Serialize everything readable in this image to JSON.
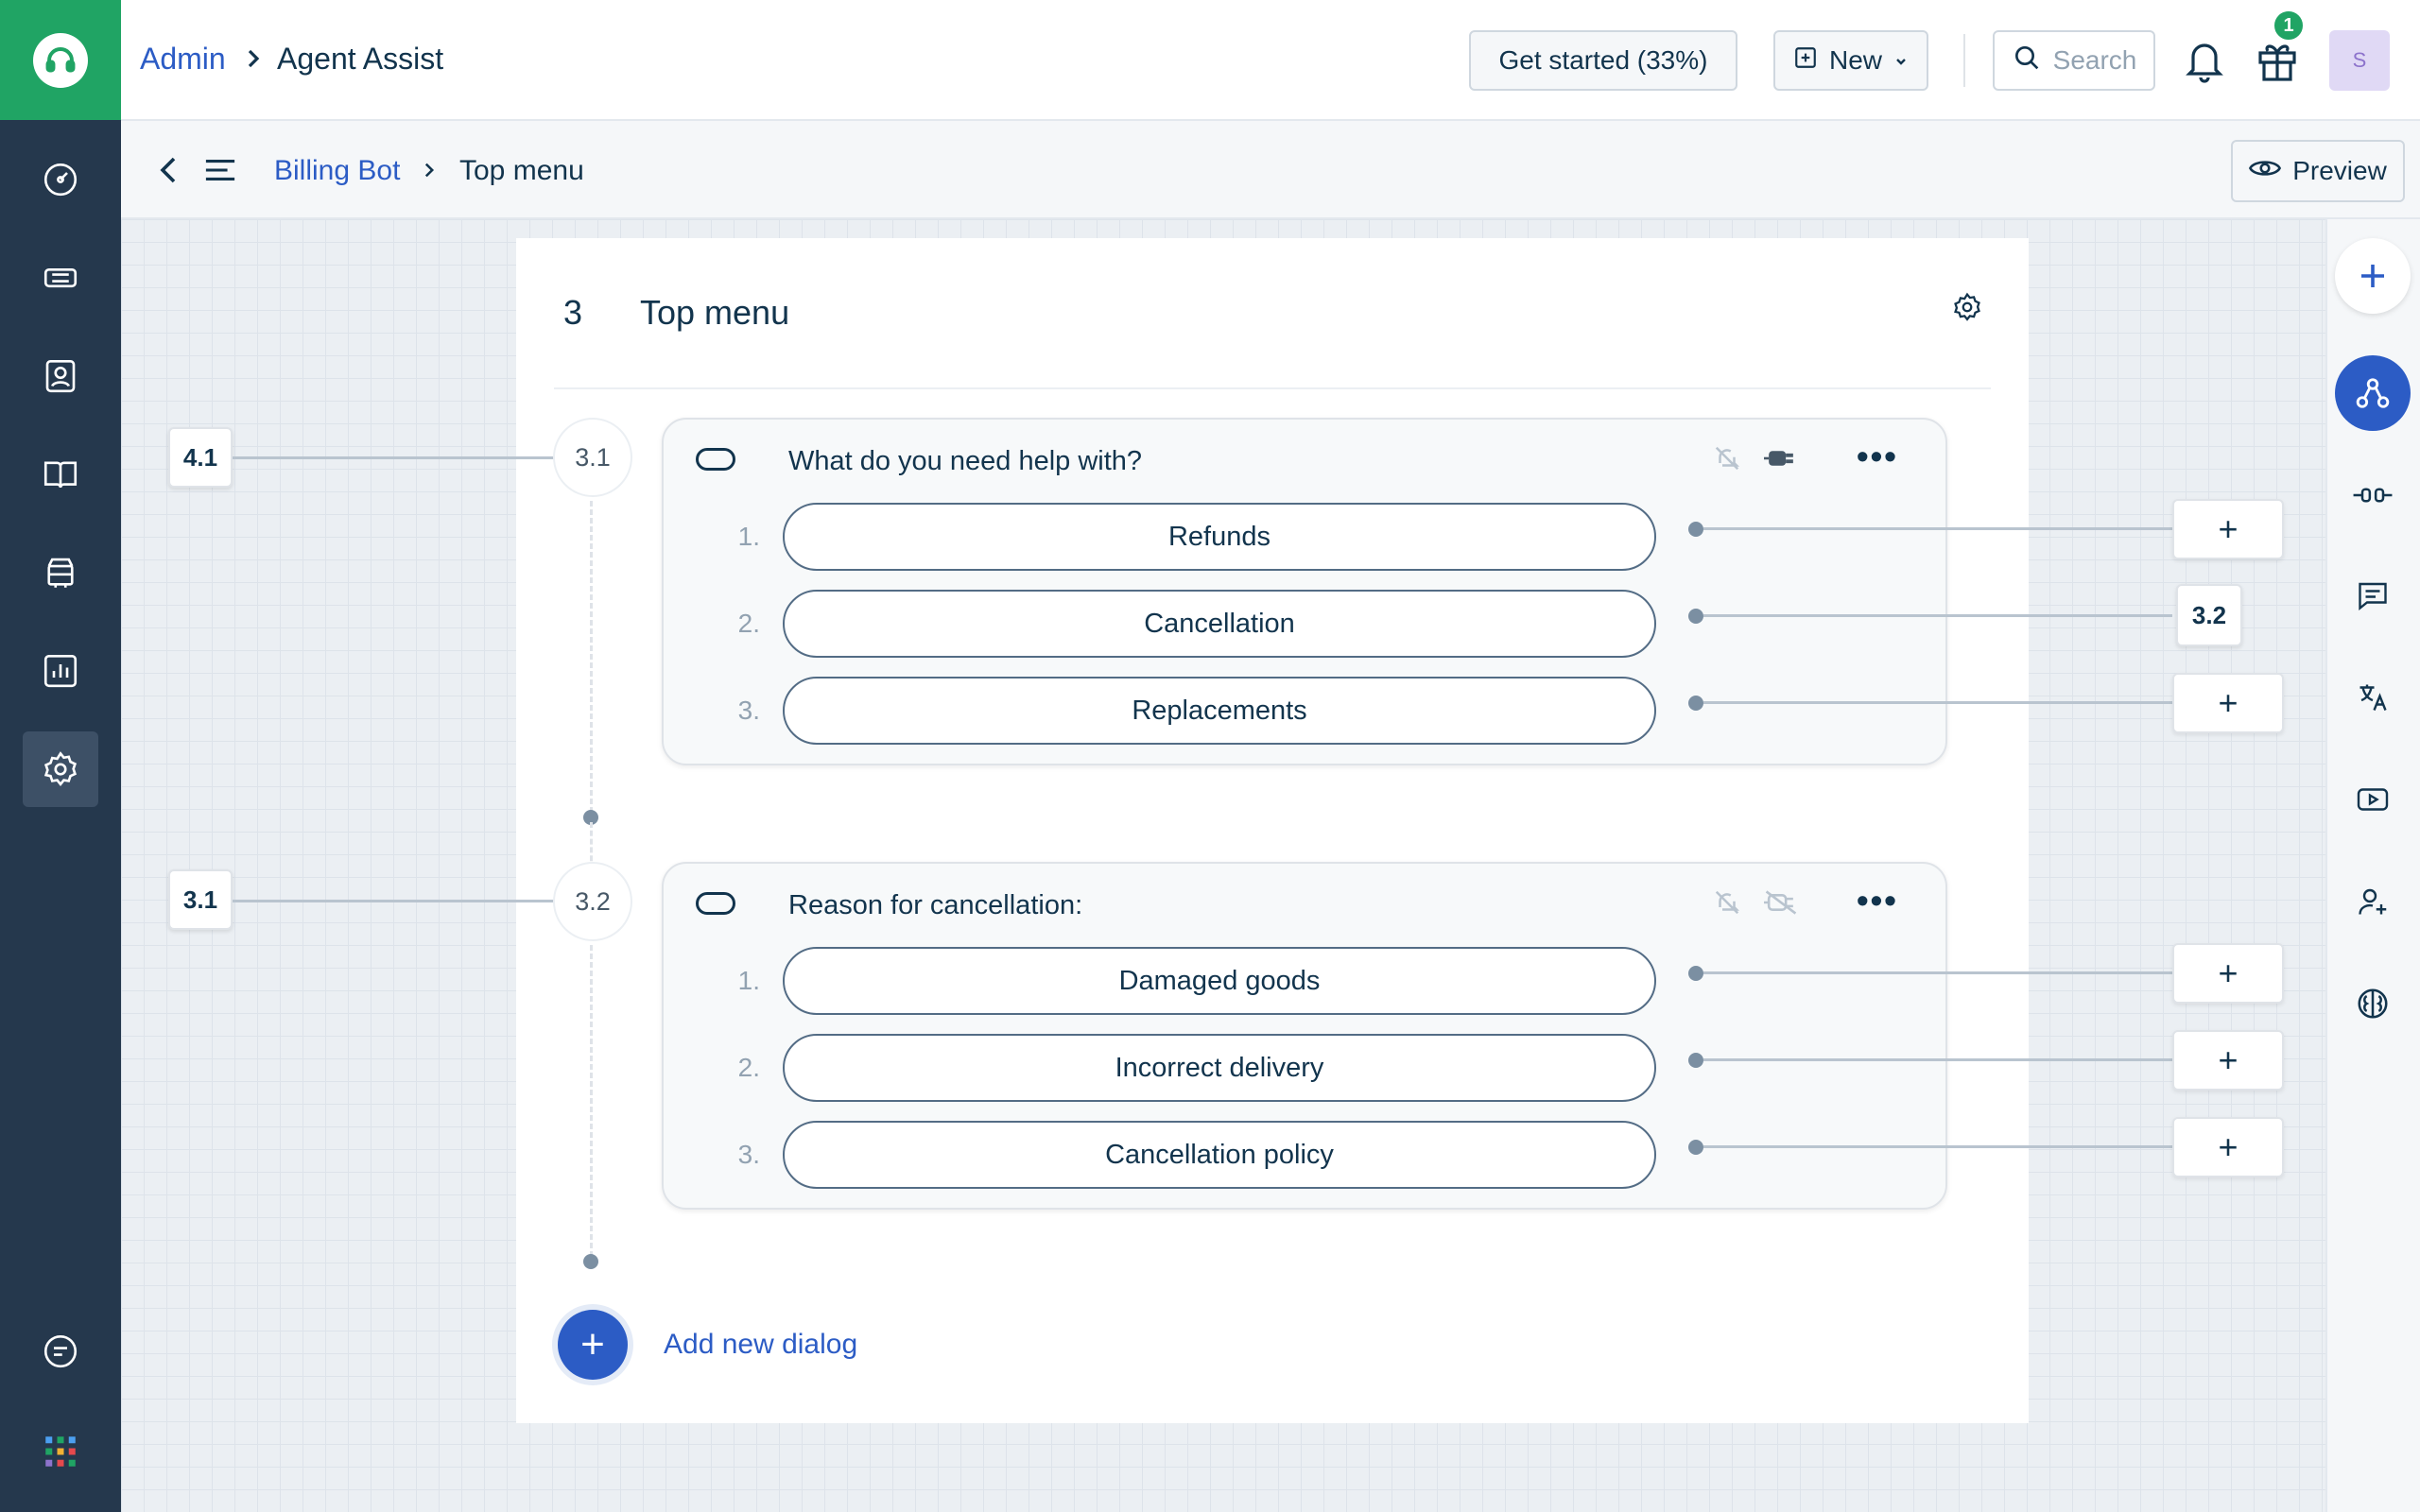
{
  "header": {
    "breadcrumb_root": "Admin",
    "breadcrumb_title": "Agent Assist",
    "get_started": "Get started (33%)",
    "new_button": "New",
    "search_placeholder": "Search",
    "notifications_badge": "1",
    "avatar_initial": "S"
  },
  "subheader": {
    "bot_name": "Billing Bot",
    "current": "Top menu",
    "preview": "Preview"
  },
  "panel": {
    "number": "3",
    "title": "Top menu"
  },
  "dialogs": [
    {
      "step": "3.1",
      "incoming_ref": "4.1",
      "question": "What do you need help with?",
      "options": [
        {
          "num": "1.",
          "label": "Refunds",
          "target": "+"
        },
        {
          "num": "2.",
          "label": "Cancellation",
          "target": "3.2"
        },
        {
          "num": "3.",
          "label": "Replacements",
          "target": "+"
        }
      ]
    },
    {
      "step": "3.2",
      "incoming_ref": "3.1",
      "question": "Reason for cancellation:",
      "options": [
        {
          "num": "1.",
          "label": "Damaged goods",
          "target": "+"
        },
        {
          "num": "2.",
          "label": "Incorrect delivery",
          "target": "+"
        },
        {
          "num": "3.",
          "label": "Cancellation policy",
          "target": "+"
        }
      ]
    }
  ],
  "add_dialog": {
    "icon": "+",
    "label": "Add new dialog"
  },
  "colors": {
    "brand_green": "#20a464",
    "nav_bg": "#25384d",
    "link_blue": "#2c5cc5"
  }
}
